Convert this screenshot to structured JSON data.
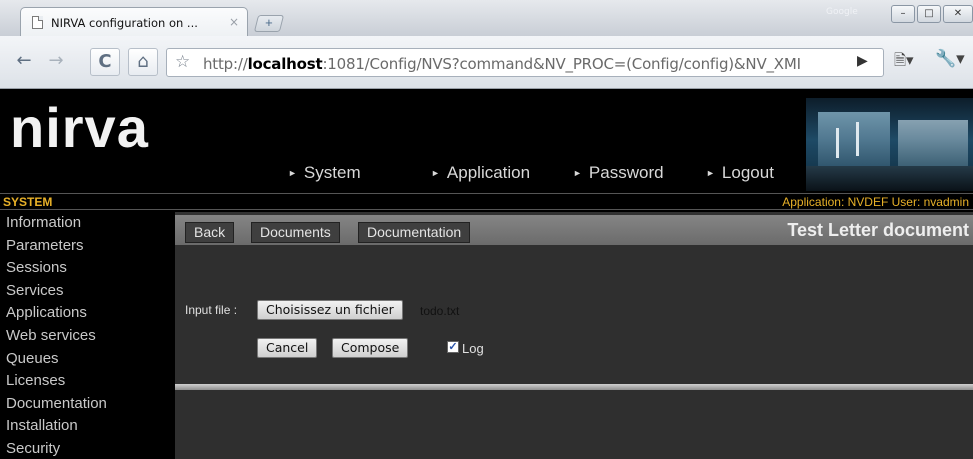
{
  "browser": {
    "tab_title": "NIRVA configuration on ...",
    "tab_close": "×",
    "new_tab": "+",
    "google_label": "Google",
    "window_buttons": {
      "minimize": "–",
      "maximize": "□",
      "close": "✕"
    },
    "url_prefix": "http://",
    "url_host": "localhost",
    "url_rest": ":1081/Config/NVS?command&NV_PROC=(Config/config)&NV_XMI"
  },
  "header": {
    "logo": "nirva",
    "nav": [
      "System",
      "Application",
      "Password",
      "Logout"
    ]
  },
  "system_bar": {
    "title": "SYSTEM",
    "application_user": "Application: NVDEF  User: nvadmin"
  },
  "sidebar": {
    "items": [
      "Information",
      "Parameters",
      "Sessions",
      "Services",
      "Applications",
      "Web services",
      "Queues",
      "Licenses",
      "Documentation",
      "Installation",
      "Security"
    ]
  },
  "main": {
    "buttons": [
      "Back",
      "Documents",
      "Documentation"
    ],
    "title": "Test Letter document",
    "form": {
      "input_label": "Input file :",
      "choose_file_label": "Choisissez un fichier",
      "filename": "todo.txt",
      "cancel_label": "Cancel",
      "compose_label": "Compose",
      "log_label": "Log",
      "log_checked": true
    }
  },
  "colors": {
    "accent": "#e8b128",
    "page_bg": "#000000",
    "panel_bg": "#2f2f2f"
  }
}
